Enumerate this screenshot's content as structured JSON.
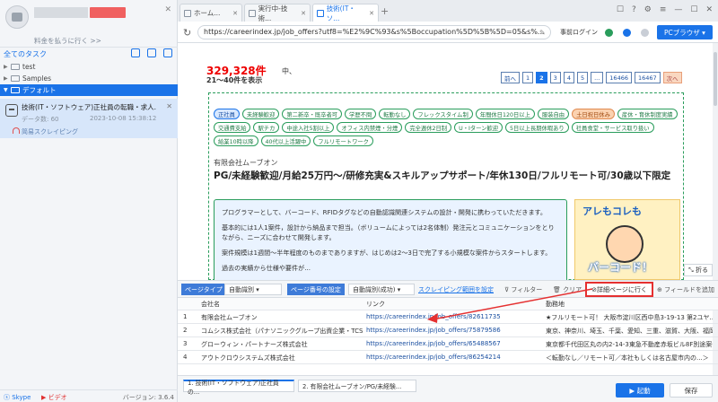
{
  "sidebar": {
    "pay_link": "料金を払うに行く >>",
    "tasks_label": "全てのタスク",
    "folders": [
      {
        "name": "test",
        "expanded": false
      },
      {
        "name": "Samples",
        "expanded": false
      },
      {
        "name": "デフォルト",
        "expanded": true
      }
    ],
    "task": {
      "name": "技術(IT・ソフトウェア)正社員の転職・求人...",
      "data_count": "データ数: 60",
      "time": "2023-10-08 15:38:12",
      "mode": "简易スクレイピング"
    },
    "footer": {
      "skype": "Skype",
      "video": "ビデオ",
      "version": "バージョン: 3.6.4"
    }
  },
  "tabs": [
    {
      "label": "ホーム..."
    },
    {
      "label": "実行中-技術..."
    },
    {
      "label": "技術(IT・ソ..."
    }
  ],
  "address": {
    "url": "https://careerindex.jp/job_offers?utf8=%E2%9C%93&s%5Boccupation%5D%5B%5D=05&s%...",
    "pre_login": "事前ログイン",
    "pc_browser": "PCブラウザ"
  },
  "page": {
    "count": "329,328件",
    "count_suffix": "中、",
    "range": "21〜40件を表示",
    "pager": [
      {
        "label": "前へ",
        "state": "normal"
      },
      {
        "label": "1",
        "state": "normal"
      },
      {
        "label": "2",
        "state": "active"
      },
      {
        "label": "3",
        "state": "normal"
      },
      {
        "label": "4",
        "state": "normal"
      },
      {
        "label": "5",
        "state": "normal"
      },
      {
        "label": "...",
        "state": "normal"
      },
      {
        "label": "16466",
        "state": "normal"
      },
      {
        "label": "16467",
        "state": "normal"
      },
      {
        "label": "次へ",
        "state": "next"
      }
    ],
    "tags": [
      {
        "text": "正社員",
        "style": "first"
      },
      {
        "text": "未経験歓迎",
        "style": "normal"
      },
      {
        "text": "第二新卒・既卒者可",
        "style": "normal"
      },
      {
        "text": "学歴不問",
        "style": "normal"
      },
      {
        "text": "転勤なし",
        "style": "normal"
      },
      {
        "text": "フレックスタイム制",
        "style": "normal"
      },
      {
        "text": "年間休日120日以上",
        "style": "normal"
      },
      {
        "text": "服装自由",
        "style": "normal"
      },
      {
        "text": "土日祝日休み",
        "style": "orange"
      },
      {
        "text": "産休・育休制度実績",
        "style": "normal"
      },
      {
        "text": "交通費支給",
        "style": "normal"
      },
      {
        "text": "駅チカ",
        "style": "normal"
      },
      {
        "text": "中途入社5割以上",
        "style": "normal"
      },
      {
        "text": "オフィス内禁煙・分煙",
        "style": "normal"
      },
      {
        "text": "完全週休2日制",
        "style": "normal"
      },
      {
        "text": "U・Iターン歓迎",
        "style": "normal"
      },
      {
        "text": "5日以上長期休暇あり",
        "style": "normal"
      },
      {
        "text": "社員食堂・サービス取り扱い",
        "style": "normal"
      },
      {
        "text": "給業10時以降",
        "style": "normal"
      },
      {
        "text": "40代以上活躍中",
        "style": "normal"
      },
      {
        "text": "フルリモートワーク",
        "style": "normal"
      }
    ],
    "company_prefix": "有限会社ムーブオン",
    "job_title": "PG/未経験歓迎/月給25万円～/研修充実&スキルアップサポート/年休130日/フルリモート可/30歳以下限定",
    "desc": [
      "プログラマーとして、バーコード、RFIDタグなどの自動認識関連システムの設計・開発に携わっていただきます。",
      "基本的には1人1案件，設計から納品まで担当。（ボリュームによっては2名体制）発注元とコミュニケーションをとりながら、ニーズに合わせて開発します。",
      "案件規模は1週間～半年程度のものまでありますが、はじめは2～3日で完了する小規模な案件からスタートします。",
      "過去の実績から仕様や要件が..."
    ],
    "banner_top": "アレもコレも",
    "banner_bottom": "バーコード！",
    "fold": "折る"
  },
  "datatools": {
    "page_type_label": "ページタイプ",
    "page_type_value": "自動識別",
    "page_num_label": "ページ番号の設定",
    "page_num_value": "自動識別(成功)",
    "range_link": "スクレイピング範囲を設定",
    "filter": "フィルター",
    "clear": "クリア",
    "goto_detail": "詳細ページに行く",
    "add_field": "フィールドを追加"
  },
  "grid": {
    "headers": [
      "",
      "会社名",
      "リンク",
      "勤務地"
    ],
    "rows": [
      [
        "1",
        "有限会社ムーブオン",
        "https://careerindex.jp/job_offers/82611735",
        "★フルリモート可！ 大阪市淀川区西中島3-19-13 第2ユヤ..."
      ],
      [
        "2",
        "コムシス株式会社（パナソニックグループ出資企業・TCSグ...",
        "https://careerindex.jp/job_offers/75879586",
        "東京、神奈川、埼玉、千葉、愛知、三重、滋賀、大阪、福岡いずれ..."
      ],
      [
        "3",
        "グローウィン・パートナーズ株式会社",
        "https://careerindex.jp/job_offers/65488567",
        "東京都千代田区丸の内2-14-3東急不動産赤坂ビル8F別途案件..."
      ],
      [
        "4",
        "アウトクロウシステムズ株式会社",
        "https://careerindex.jp/job_offers/86254214",
        "＜転勤なし／リモート可／本社もしくは名古屋市内の...＞"
      ]
    ]
  },
  "footer": {
    "tabs": [
      "1. 技術(IT・ソフトウェア)正社員の...",
      "2. 有限会社ムーブオン/PG/未経験..."
    ],
    "run": "▶ 起動",
    "save": "保存"
  },
  "colors": {
    "accent": "#1a73e8",
    "highlight": "#e53030",
    "count": "#ee0000"
  }
}
